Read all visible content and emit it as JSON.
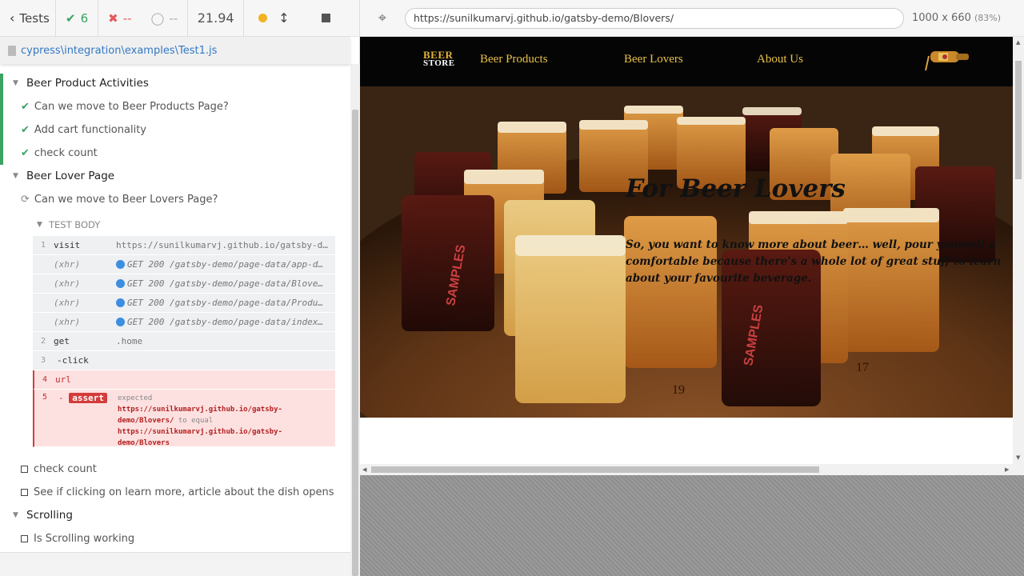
{
  "topbar": {
    "tests_label": "Tests",
    "passed_count": "6",
    "failed_count": "--",
    "pending_count": "--",
    "duration": "21.94"
  },
  "spec_file": "cypress\\integration\\examples\\Test1.js",
  "runnables": {
    "suite1": {
      "title": "Beer Product Activities",
      "tests": [
        "Can we move to Beer Products Page?",
        "Add cart functionality",
        "check count"
      ]
    },
    "suite2": {
      "title": "Beer Lover Page",
      "running_test": "Can we move to Beer Lovers Page?",
      "test_body_label": "TEST BODY",
      "pending_tests": [
        "check count",
        "See if clicking on learn more, article about the dish opens"
      ]
    },
    "suite3": {
      "title": "Scrolling",
      "pending_tests": [
        "Is Scrolling working"
      ]
    }
  },
  "commands": [
    {
      "num": "1",
      "name": "visit",
      "msg": "https://sunilkumarvj.github.io/gatsby-demo/Bl…"
    },
    {
      "num": "",
      "name": "(xhr)",
      "msg": "GET 200 /gatsby-demo/page-data/app-d…"
    },
    {
      "num": "",
      "name": "(xhr)",
      "msg": "GET 200 /gatsby-demo/page-data/Blove…"
    },
    {
      "num": "",
      "name": "(xhr)",
      "msg": "GET 200 /gatsby-demo/page-data/Produ…"
    },
    {
      "num": "",
      "name": "(xhr)",
      "msg": "GET 200 /gatsby-demo/page-data/index…"
    },
    {
      "num": "2",
      "name": "get",
      "msg": ".home"
    },
    {
      "num": "3",
      "name": "-click",
      "msg": ""
    },
    {
      "num": "4",
      "name": "url",
      "msg": ""
    },
    {
      "num": "5",
      "name": "-",
      "badge": "assert"
    }
  ],
  "assert_message": {
    "expected_label": "expected",
    "expected_value": "https://sunilkumarvj.github.io/gatsby-demo/Blovers/",
    "to_equal_label": "to equal",
    "actual_value": "https://sunilkumarvj.github.io/gatsby-demo/Blovers"
  },
  "aut": {
    "url": "https://sunilkumarvj.github.io/gatsby-demo/Blovers/",
    "viewport": "1000 x 660",
    "scale": "(83%)",
    "site": {
      "logo_line1": "BEER",
      "logo_line2": "STORE",
      "nav": [
        "Beer Products",
        "Beer Lovers",
        "About Us"
      ],
      "hero_title": "For Beer Lovers",
      "hero_text": "So, you want to know more about beer… well, pour yourself a comfortable because there's a whole lot of great stuff to learn about your favourite beverage.",
      "glass_labels": [
        "SAMPLES",
        "SAMPLES"
      ],
      "board_numbers": [
        "19",
        "17"
      ]
    }
  },
  "colors": {
    "passed": "#3ba363",
    "failed": "#e45a5a",
    "link": "#3379c4",
    "error_bg": "#fde1e1",
    "nav_gold": "#e8c14a"
  }
}
